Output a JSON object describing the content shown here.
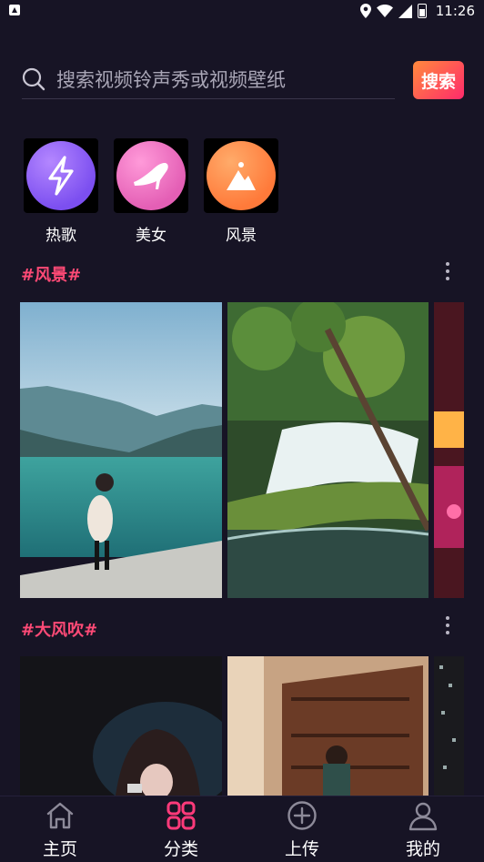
{
  "status_bar": {
    "time": "11:26"
  },
  "search": {
    "placeholder": "搜索视频铃声秀或视频壁纸",
    "button_label": "搜索"
  },
  "categories": [
    {
      "label": "热歌",
      "icon": "lightning-icon",
      "color": "#8a5cf6"
    },
    {
      "label": "美女",
      "icon": "high-heel-icon",
      "color": "#f06bbf"
    },
    {
      "label": "风景",
      "icon": "mountain-icon",
      "color": "#ff8c4a"
    }
  ],
  "sections": [
    {
      "title": "#风景#"
    },
    {
      "title": "#大风吹#"
    }
  ],
  "bottom_nav": [
    {
      "label": "主页",
      "icon": "home-icon"
    },
    {
      "label": "分类",
      "icon": "grid-icon",
      "active_color": "#ff3a7a"
    },
    {
      "label": "上传",
      "icon": "plus-circle-icon"
    },
    {
      "label": "我的",
      "icon": "user-icon"
    }
  ],
  "colors": {
    "background": "#171425",
    "accent": "#ff4a76"
  }
}
